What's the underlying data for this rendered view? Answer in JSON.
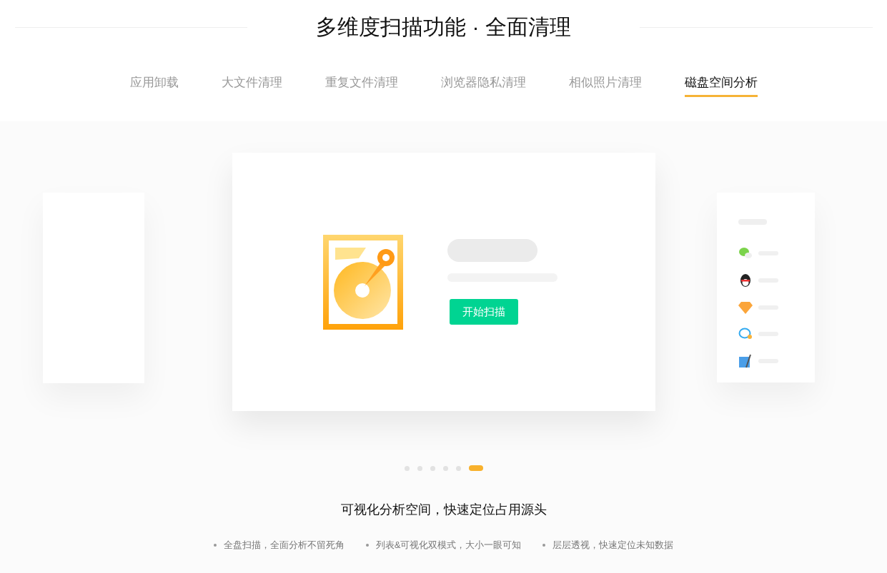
{
  "heading": "多维度扫描功能 · 全面清理",
  "tabs": [
    {
      "label": "应用卸载",
      "selected": false
    },
    {
      "label": "大文件清理",
      "selected": false
    },
    {
      "label": "重复文件清理",
      "selected": false
    },
    {
      "label": "浏览器隐私清理",
      "selected": false
    },
    {
      "label": "相似照片清理",
      "selected": false
    },
    {
      "label": "磁盘空间分析",
      "selected": true
    }
  ],
  "slide": {
    "button": "开始扫描"
  },
  "pagination": [
    {
      "selected": false
    },
    {
      "selected": false
    },
    {
      "selected": false
    },
    {
      "selected": false
    },
    {
      "selected": false
    },
    {
      "selected": true
    }
  ],
  "caption": "可视化分析空间，快速定位占用源头",
  "features": [
    "全盘扫描，全面分析不留死角",
    "列表&可视化双模式，大小一眼可知",
    "层层透视，快速定位未知数据"
  ]
}
